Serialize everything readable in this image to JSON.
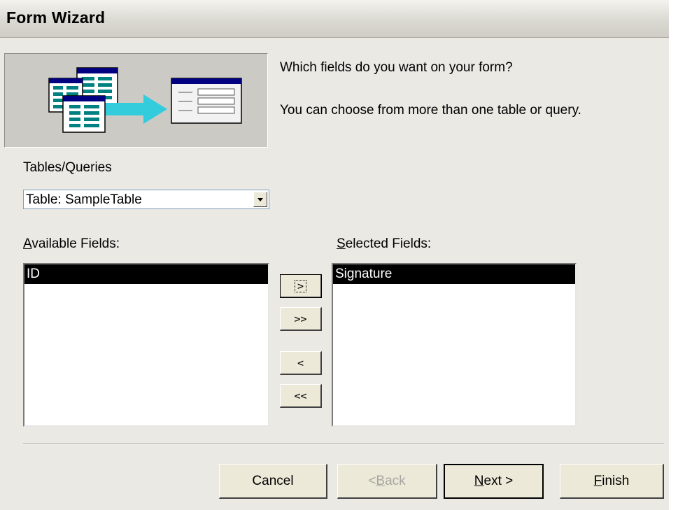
{
  "window": {
    "title": "Form Wizard"
  },
  "intro": {
    "question": "Which fields do you want on your form?",
    "hint": "You can choose from more than one table or query."
  },
  "source": {
    "label": "Tables/Queries",
    "selected": "Table: SampleTable"
  },
  "available": {
    "label_accel": "A",
    "label_rest": "vailable Fields:",
    "items": [
      "ID"
    ]
  },
  "selected": {
    "label_accel": "S",
    "label_rest": "elected Fields:",
    "items": [
      "Signature"
    ]
  },
  "move_buttons": {
    "add_one": ">",
    "add_all": ">>",
    "remove_one": "<",
    "remove_all": "<<"
  },
  "footer": {
    "cancel": "Cancel",
    "back_pre": "< ",
    "back_accel": "B",
    "back_rest": "ack",
    "next_accel": "N",
    "next_rest": "ext >",
    "finish_accel": "F",
    "finish_rest": "inish"
  },
  "colors": {
    "dialog_bg": "#ebe9e4",
    "selection_bg": "#000000",
    "table_icon_teal": "#008080",
    "arrow_cyan": "#33ccdd"
  }
}
